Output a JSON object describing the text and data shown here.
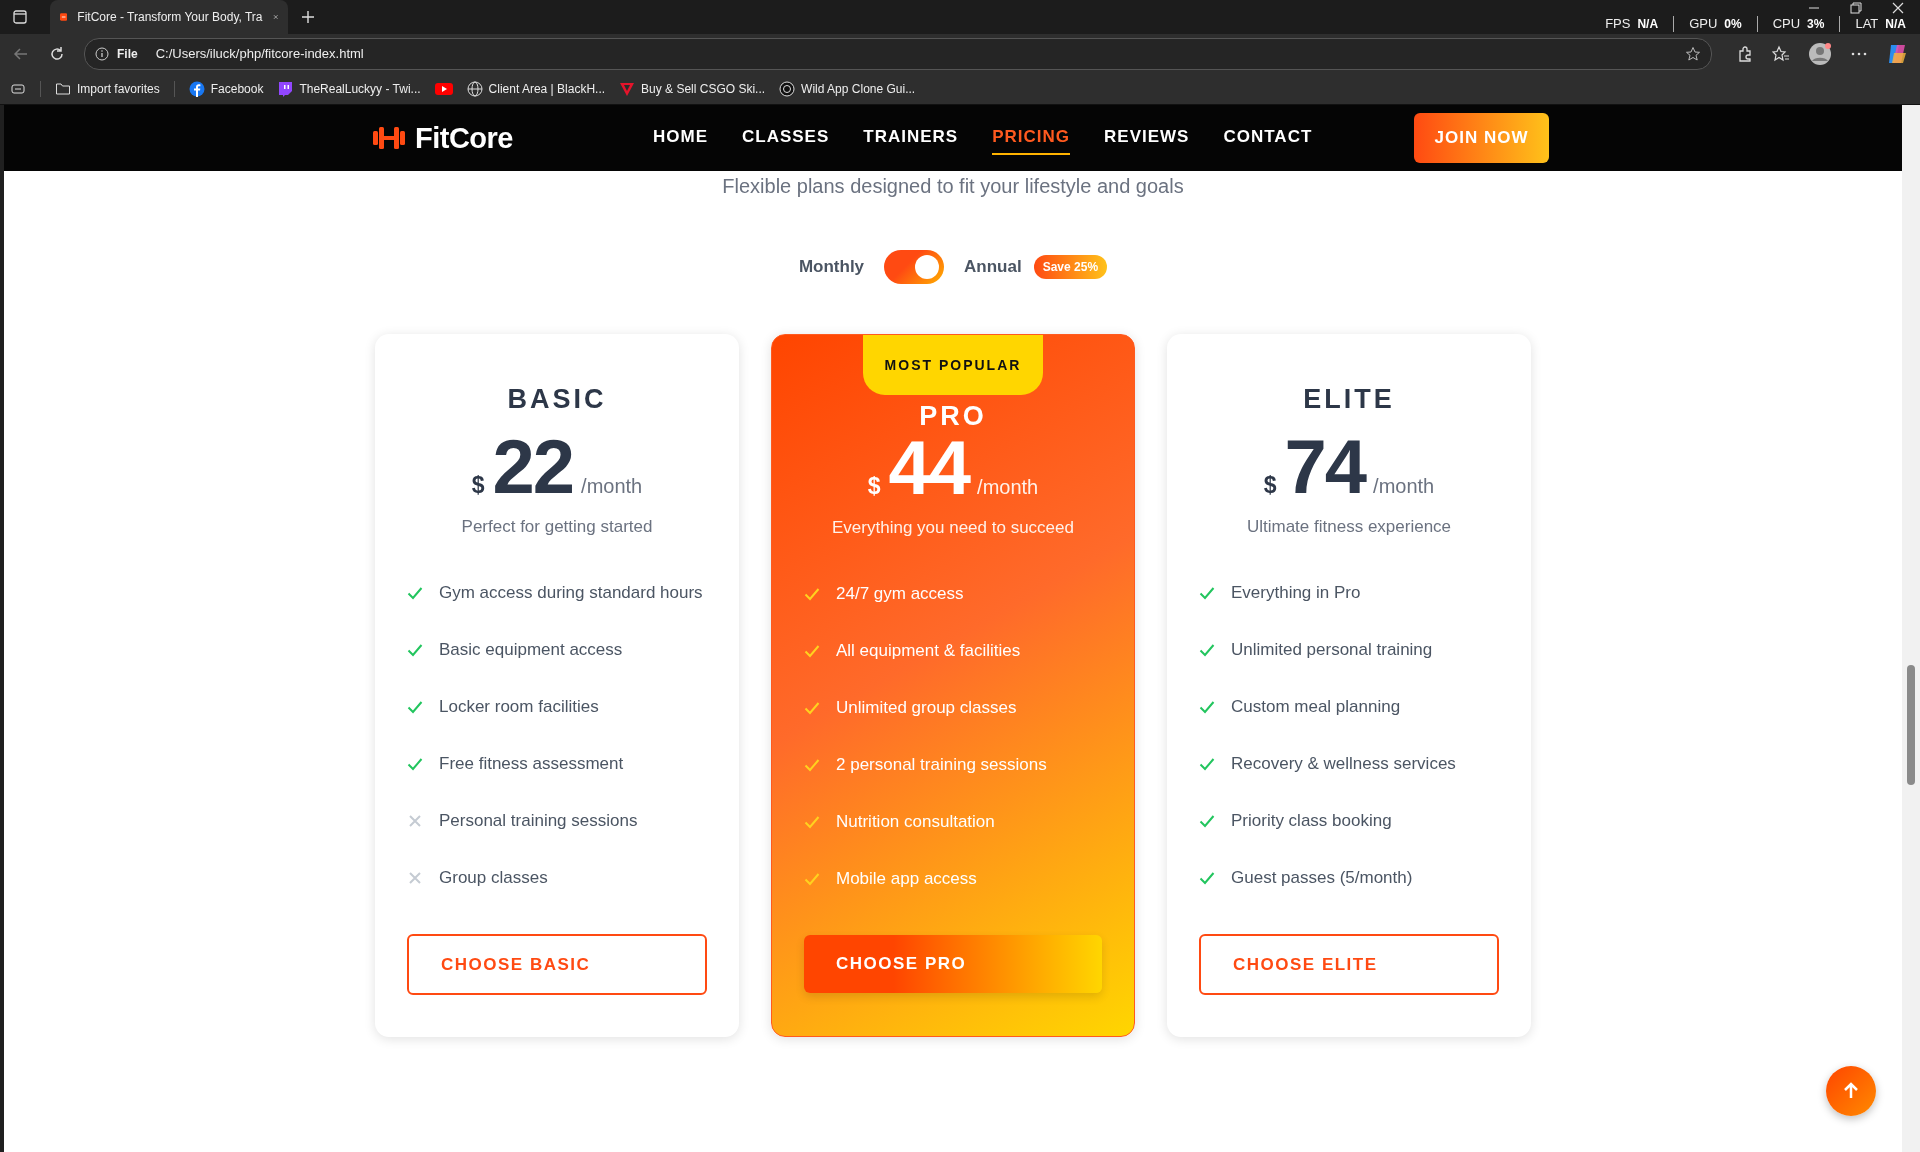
{
  "browser": {
    "tab_title": "FitCore - Transform Your Body, Tra",
    "address_label": "File",
    "url": "C:/Users/iluck/php/fitcore-index.html",
    "bookmarks": [
      "Import favorites",
      "Facebook",
      "TheRealLuckyy - Twi...",
      "Client Area | BlackH...",
      "Buy & Sell CSGO Ski...",
      "Wild App Clone Gui..."
    ],
    "stats": [
      {
        "name": "FPS",
        "value": "N/A"
      },
      {
        "name": "GPU",
        "value": "0%"
      },
      {
        "name": "CPU",
        "value": "3%"
      },
      {
        "name": "LAT",
        "value": "N/A"
      }
    ]
  },
  "nav": {
    "logo": "FitCore",
    "links": [
      {
        "label": "HOME",
        "selected": false
      },
      {
        "label": "CLASSES",
        "selected": false
      },
      {
        "label": "TRAINERS",
        "selected": false
      },
      {
        "label": "PRICING",
        "selected": true
      },
      {
        "label": "REVIEWS",
        "selected": false
      },
      {
        "label": "CONTACT",
        "selected": false
      }
    ],
    "cta": "JOIN NOW"
  },
  "subtitle": "Flexible plans designed to fit your lifestyle and goals",
  "billing": {
    "left": "Monthly",
    "right": "Annual",
    "on": true,
    "badge": "Save 25%"
  },
  "plans": [
    {
      "name": "BASIC",
      "featured": false,
      "currency": "$",
      "price": "22",
      "period": "/month",
      "description": "Perfect for getting started",
      "button": "CHOOSE BASIC",
      "features": [
        {
          "text": "Gym access during standard hours",
          "included": true
        },
        {
          "text": "Basic equipment access",
          "included": true
        },
        {
          "text": "Locker room facilities",
          "included": true
        },
        {
          "text": "Free fitness assessment",
          "included": true
        },
        {
          "text": "Personal training sessions",
          "included": false
        },
        {
          "text": "Group classes",
          "included": false
        }
      ]
    },
    {
      "name": "PRO",
      "featured": true,
      "ribbon": "MOST POPULAR",
      "currency": "$",
      "price": "44",
      "period": "/month",
      "description": "Everything you need to succeed",
      "button": "CHOOSE PRO",
      "features": [
        {
          "text": "24/7 gym access",
          "included": true
        },
        {
          "text": "All equipment & facilities",
          "included": true
        },
        {
          "text": "Unlimited group classes",
          "included": true
        },
        {
          "text": "2 personal training sessions",
          "included": true
        },
        {
          "text": "Nutrition consultation",
          "included": true
        },
        {
          "text": "Mobile app access",
          "included": true
        }
      ]
    },
    {
      "name": "ELITE",
      "featured": false,
      "currency": "$",
      "price": "74",
      "period": "/month",
      "description": "Ultimate fitness experience",
      "button": "CHOOSE ELITE",
      "features": [
        {
          "text": "Everything in Pro",
          "included": true
        },
        {
          "text": "Unlimited personal training",
          "included": true
        },
        {
          "text": "Custom meal planning",
          "included": true
        },
        {
          "text": "Recovery & wellness services",
          "included": true
        },
        {
          "text": "Priority class booking",
          "included": true
        },
        {
          "text": "Guest passes (5/month)",
          "included": true
        }
      ]
    }
  ]
}
